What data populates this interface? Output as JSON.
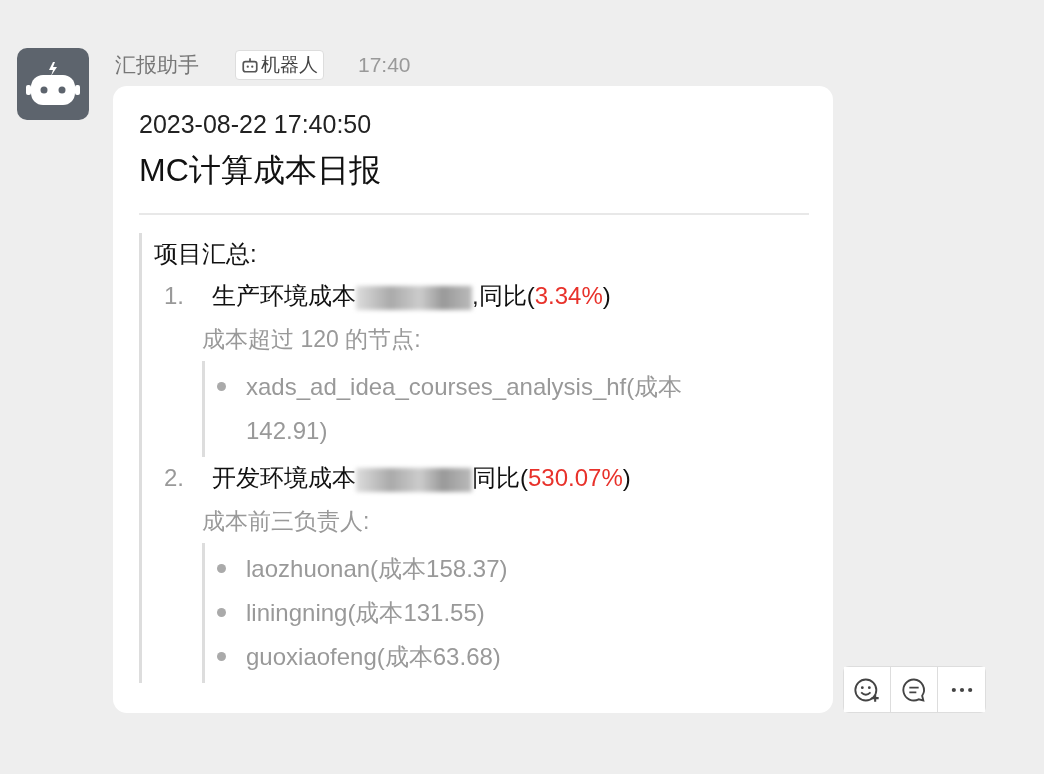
{
  "sender": {
    "name": "汇报助手",
    "badge": "机器人",
    "time": "17:40"
  },
  "message": {
    "timestamp": "2023-08-22 17:40:50",
    "title": "MC计算成本日报",
    "section_title": "项目汇总:",
    "items": [
      {
        "number": "1.",
        "label": "生产环境成本",
        "redacted": true,
        "compare": ",同比(",
        "percent": "3.34%",
        "close": ")",
        "note": "成本超过 120 的节点:",
        "bullets": [
          "xads_ad_idea_courses_analysis_hf(成本 142.91)"
        ]
      },
      {
        "number": "2.",
        "label": "开发环境成本",
        "redacted": true,
        "compare": "同比(",
        "percent": "530.07%",
        "close": ")",
        "note": "成本前三负责人:",
        "bullets": [
          "laozhuonan(成本158.37)",
          "liningning(成本131.55)",
          "guoxiaofeng(成本63.68)"
        ]
      }
    ]
  },
  "actions": [
    {
      "kind": "emoji"
    },
    {
      "kind": "comment"
    },
    {
      "kind": "more"
    }
  ]
}
